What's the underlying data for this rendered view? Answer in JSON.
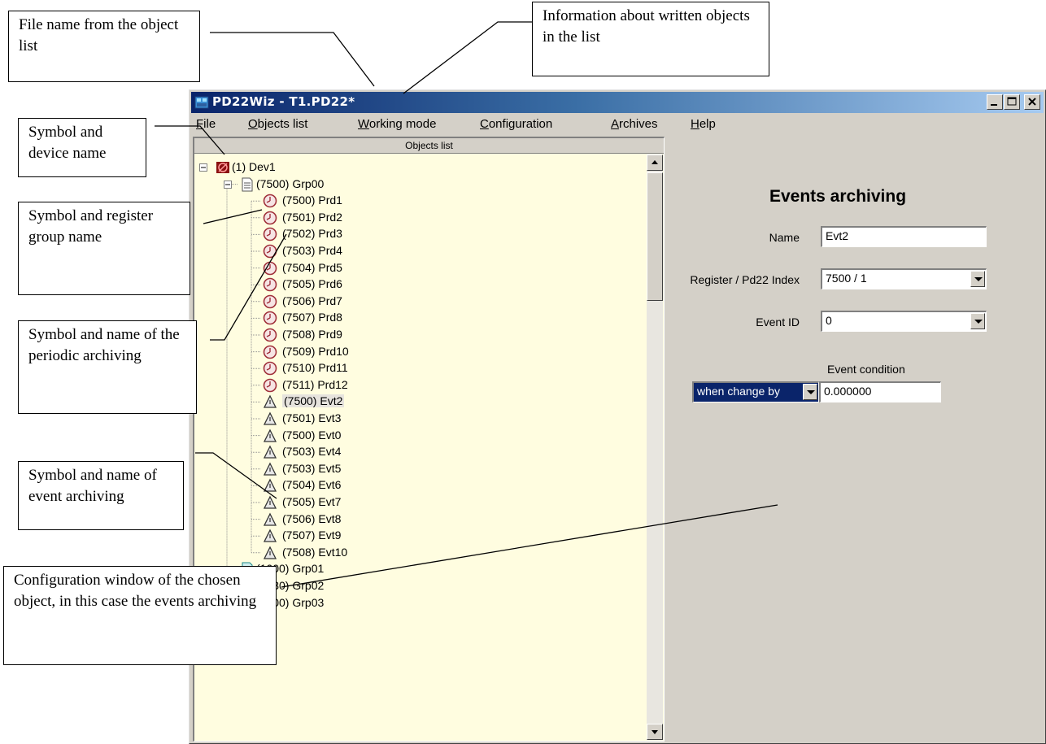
{
  "callouts": [
    {
      "id": "file-name",
      "text": "File name from the object list"
    },
    {
      "id": "info",
      "text": "Information about written objects in the list"
    },
    {
      "id": "device",
      "text": "Symbol and device name"
    },
    {
      "id": "group",
      "text": "Symbol and register group name"
    },
    {
      "id": "periodic",
      "text": "Symbol and name of the periodic archiving"
    },
    {
      "id": "event",
      "text": "Symbol and name of event archiving"
    },
    {
      "id": "config",
      "text": "Configuration window of the chosen object, in this case the events archiving"
    }
  ],
  "window": {
    "title": "PD22Wiz - T1.PD22*",
    "controls": {
      "minimize": "_",
      "maximize": "□",
      "close": "×"
    }
  },
  "menu": [
    {
      "label": "File",
      "accel": "F"
    },
    {
      "label": "Objects list",
      "accel": "O"
    },
    {
      "label": "Working mode",
      "accel": "W"
    },
    {
      "label": "Configuration",
      "accel": "C"
    },
    {
      "label": "Archives",
      "accel": "A"
    },
    {
      "label": "Help",
      "accel": "H"
    }
  ],
  "tree": {
    "header": "Objects list",
    "nodes": [
      {
        "label": "(1) Dev1",
        "icon": "device-icon",
        "level": 0,
        "expander": "minus"
      },
      {
        "label": "(7500) Grp00",
        "icon": "register-group-icon",
        "level": 1,
        "expander": "minus"
      },
      {
        "label": "(7500) Prd1",
        "icon": "periodic-archive-icon",
        "level": 2
      },
      {
        "label": "(7501) Prd2",
        "icon": "periodic-archive-icon",
        "level": 2
      },
      {
        "label": "(7502) Prd3",
        "icon": "periodic-archive-icon",
        "level": 2
      },
      {
        "label": "(7503) Prd4",
        "icon": "periodic-archive-icon",
        "level": 2
      },
      {
        "label": "(7504) Prd5",
        "icon": "periodic-archive-icon",
        "level": 2
      },
      {
        "label": "(7505) Prd6",
        "icon": "periodic-archive-icon",
        "level": 2
      },
      {
        "label": "(7506) Prd7",
        "icon": "periodic-archive-icon",
        "level": 2
      },
      {
        "label": "(7507) Prd8",
        "icon": "periodic-archive-icon",
        "level": 2
      },
      {
        "label": "(7508) Prd9",
        "icon": "periodic-archive-icon",
        "level": 2
      },
      {
        "label": "(7509) Prd10",
        "icon": "periodic-archive-icon",
        "level": 2
      },
      {
        "label": "(7510) Prd11",
        "icon": "periodic-archive-icon",
        "level": 2
      },
      {
        "label": "(7511) Prd12",
        "icon": "periodic-archive-icon",
        "level": 2
      },
      {
        "label": "(7500) Evt2",
        "icon": "event-archive-icon",
        "level": 2,
        "selected": true
      },
      {
        "label": "(7501) Evt3",
        "icon": "event-archive-icon",
        "level": 2
      },
      {
        "label": "(7500) Evt0",
        "icon": "event-archive-icon",
        "level": 2
      },
      {
        "label": "(7503) Evt4",
        "icon": "event-archive-icon",
        "level": 2
      },
      {
        "label": "(7503) Evt5",
        "icon": "event-archive-icon",
        "level": 2
      },
      {
        "label": "(7504) Evt6",
        "icon": "event-archive-icon",
        "level": 2
      },
      {
        "label": "(7505) Evt7",
        "icon": "event-archive-icon",
        "level": 2
      },
      {
        "label": "(7506) Evt8",
        "icon": "event-archive-icon",
        "level": 2
      },
      {
        "label": "(7507) Evt9",
        "icon": "event-archive-icon",
        "level": 2
      },
      {
        "label": "(7508) Evt10",
        "icon": "event-archive-icon",
        "level": 2
      },
      {
        "label": "(1000) Grp01",
        "icon": "register-group-written-icon",
        "level": 1
      },
      {
        "label": "(7530) Grp02",
        "icon": "register-group-icon",
        "level": 1
      },
      {
        "label": "(7500) Grp03",
        "icon": "register-group-icon",
        "level": 1
      }
    ]
  },
  "config": {
    "title": "Events archiving",
    "name_label": "Name",
    "name_value": "Evt2",
    "register_label": "Register / Pd22 Index",
    "register_value": "7500 / 1",
    "event_id_label": "Event ID",
    "event_id_value": "0",
    "condition_label": "Event condition",
    "condition_select": "when change by",
    "condition_value": "0.000000"
  },
  "colors": {
    "tree_background": "#fffde0",
    "dialog_face": "#d4d0c8",
    "title_bar": "#0a246a",
    "periodic_icon": "#a0303a",
    "device_icon": "#8b1010"
  }
}
